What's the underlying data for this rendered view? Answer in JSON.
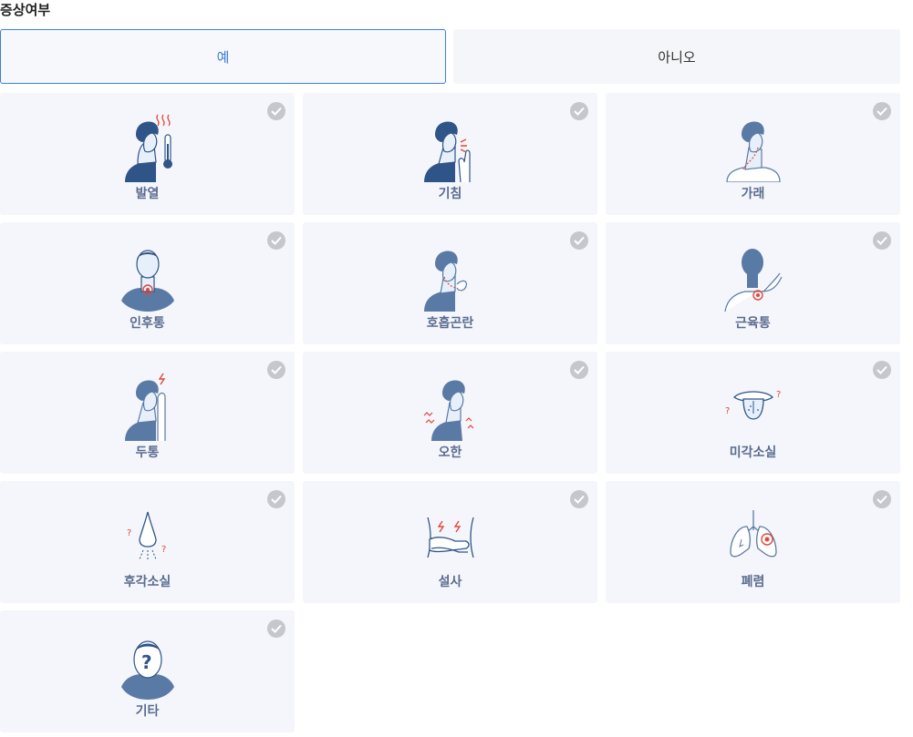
{
  "header": {
    "title": "증상여부"
  },
  "toggle": {
    "yes_label": "예",
    "no_label": "아니오",
    "selected": "yes"
  },
  "symptoms": [
    {
      "label": "발열",
      "icon": "fever-icon"
    },
    {
      "label": "기침",
      "icon": "cough-icon"
    },
    {
      "label": "가래",
      "icon": "phlegm-icon"
    },
    {
      "label": "인후통",
      "icon": "sore-throat-icon"
    },
    {
      "label": "호흡곤란",
      "icon": "breathing-difficulty-icon"
    },
    {
      "label": "근육통",
      "icon": "muscle-pain-icon"
    },
    {
      "label": "두통",
      "icon": "headache-icon"
    },
    {
      "label": "오한",
      "icon": "chills-icon"
    },
    {
      "label": "미각소실",
      "icon": "taste-loss-icon"
    },
    {
      "label": "후각소실",
      "icon": "smell-loss-icon"
    },
    {
      "label": "설사",
      "icon": "diarrhea-icon"
    },
    {
      "label": "폐렴",
      "icon": "pneumonia-icon"
    },
    {
      "label": "기타",
      "icon": "other-icon"
    }
  ],
  "colors": {
    "accent": "#3b82d6",
    "card_bg": "#f5f6fb",
    "label": "#5a6c8f",
    "icon_dark": "#2f5588",
    "icon_alert": "#e2463b",
    "check_bg": "#c5c7cc"
  }
}
